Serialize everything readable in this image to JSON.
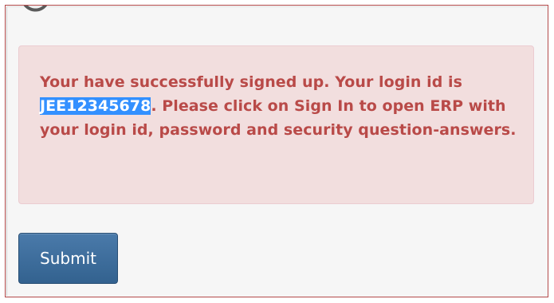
{
  "alert": {
    "message_before": "Your have successfully signed up. Your login id is ",
    "login_id": "JEE12345678",
    "message_after": ". Please click on Sign In to open ERP with your login id, password and security question-answers."
  },
  "form": {
    "submit_label": "Submit"
  },
  "colors": {
    "alert_background": "#f2dede",
    "alert_text": "#b94a48",
    "selection_highlight": "#3390ff",
    "button_blue": "#3d6d9c"
  },
  "icons": {
    "logo_fragment": "logo-fragment-icon"
  }
}
